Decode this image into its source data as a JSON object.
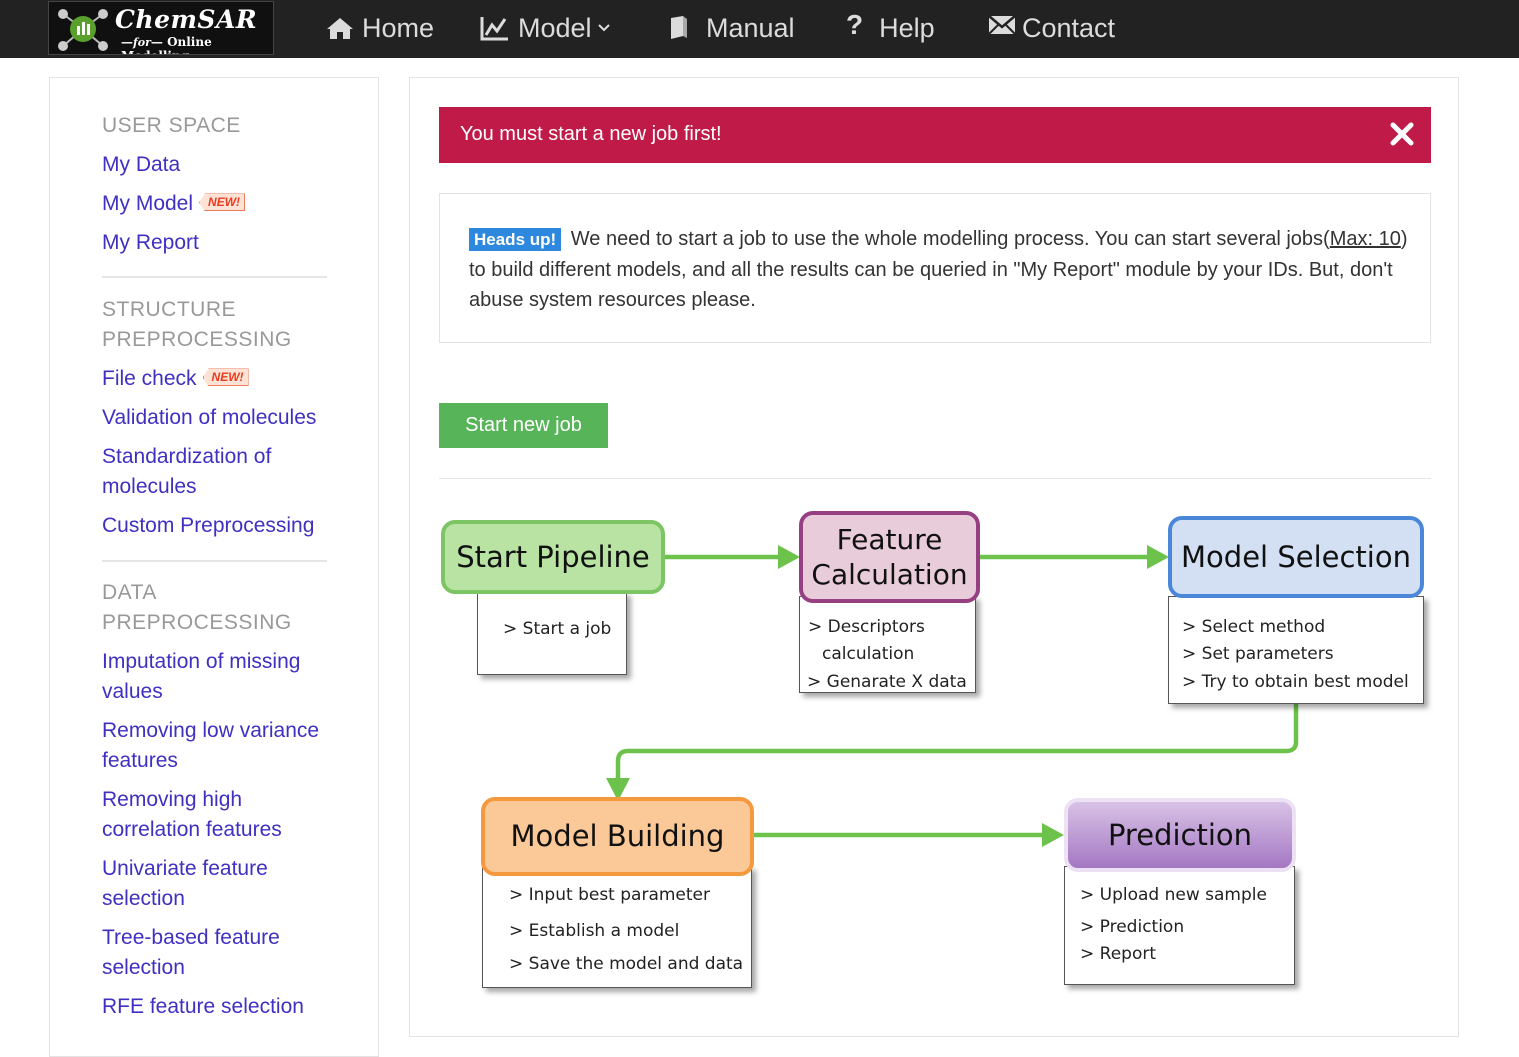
{
  "brand": {
    "title": "ChemSAR",
    "tagline": "Online Modelling"
  },
  "nav": [
    {
      "label": "Home",
      "icon": "home-icon"
    },
    {
      "label": "Model",
      "icon": "chart-icon",
      "dropdown": true
    },
    {
      "label": "Manual",
      "icon": "book-icon"
    },
    {
      "label": "Help",
      "icon": "question-icon"
    },
    {
      "label": "Contact",
      "icon": "envelope-icon"
    }
  ],
  "sidebar": {
    "user_space_header": "USER SPACE",
    "my_data": "My Data",
    "my_model": "My Model",
    "my_report": "My Report",
    "new_badge": "NEW!",
    "structure_header_1": "STRUCTURE",
    "structure_header_2": "PREPROCESSING",
    "file_check": "File check",
    "validation": "Validation of molecules",
    "standardization_1": "Standardization of",
    "standardization_2": "molecules",
    "custom": "Custom Preprocessing",
    "data_header_1": "DATA",
    "data_header_2": "PREPROCESSING",
    "imputation_1": "Imputation of missing",
    "imputation_2": "values",
    "low_var_1": "Removing low variance",
    "low_var_2": "features",
    "high_corr_1": "Removing high",
    "high_corr_2": "correlation features",
    "univariate_1": "Univariate feature",
    "univariate_2": "selection",
    "tree_1": "Tree-based feature",
    "tree_2": "selection",
    "rfe": "RFE feature selection"
  },
  "alert": {
    "message": "You must start a new job first!",
    "close_symbol": "×"
  },
  "info": {
    "label": "Heads up!",
    "text_1": " We need to start a job to use the whole modelling process. You can start several jobs(",
    "max": "Max: 10",
    "text_2": ") to build different models, and all the results can be queried in \"My Report\" module by your IDs. But, don't abuse system resources please."
  },
  "start_button": "Start new job",
  "flow": {
    "start_pipeline": {
      "title": "Start Pipeline",
      "lines": [
        "> Start a job"
      ]
    },
    "feature_calc": {
      "title_1": "Feature",
      "title_2": "Calculation",
      "lines": [
        "> Descriptors",
        "calculation",
        "> Genarate X data"
      ]
    },
    "model_selection": {
      "title": "Model Selection",
      "lines": [
        "> Select method",
        "> Set parameters",
        "> Try to obtain best model"
      ]
    },
    "model_building": {
      "title": "Model Building",
      "lines": [
        "> Input best parameter",
        "> Establish a model",
        "> Save the model and data"
      ]
    },
    "prediction": {
      "title": "Prediction",
      "lines": [
        "> Upload new sample",
        "> Prediction",
        "> Report"
      ]
    }
  },
  "colors": {
    "navbar": "#222222",
    "alert": "#c01b48",
    "link": "#3f30c2",
    "start_button": "#58b459",
    "heads_up": "#2e88de",
    "arrow": "#6cc24a"
  }
}
